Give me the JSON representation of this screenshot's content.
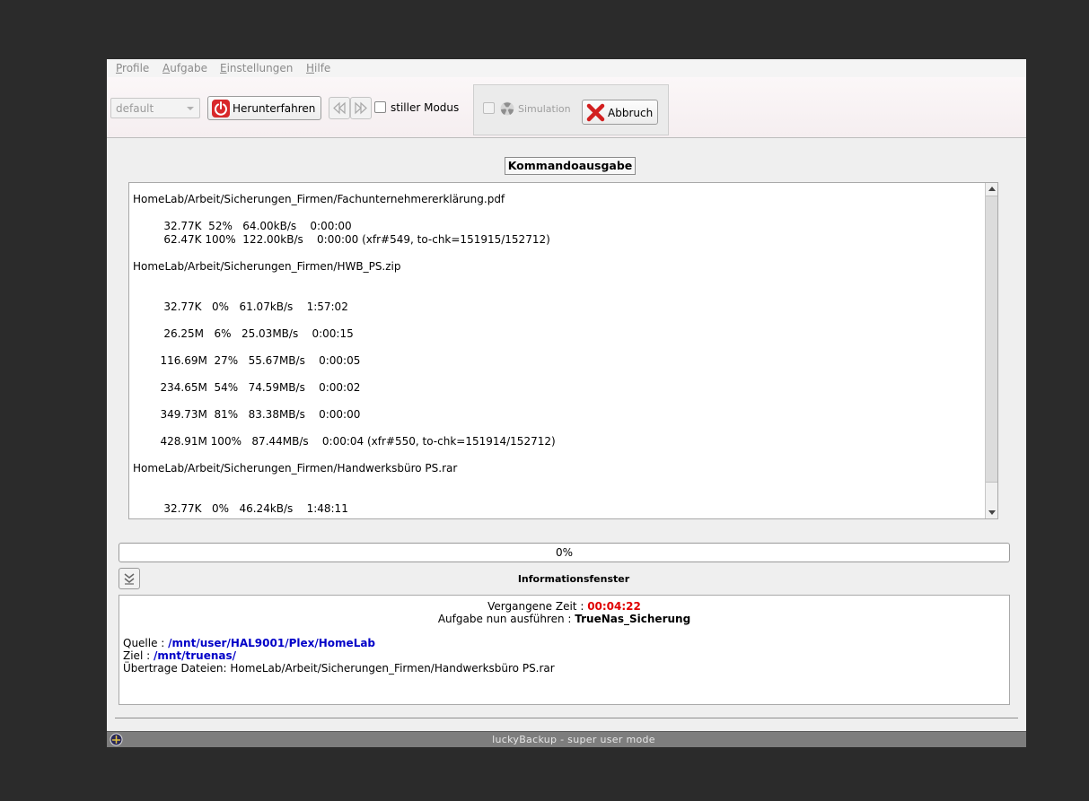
{
  "menubar": {
    "items": [
      {
        "pre": "",
        "u": "P",
        "post": "rofile"
      },
      {
        "pre": "",
        "u": "A",
        "post": "ufgabe"
      },
      {
        "pre": "",
        "u": "E",
        "post": "instellungen"
      },
      {
        "pre": "",
        "u": "H",
        "post": "ilfe"
      }
    ]
  },
  "toolbar": {
    "profile_value": "default",
    "shutdown_label": "Herunterfahren",
    "silent_label": "stiller Modus",
    "simulation_label": "Simulation",
    "abort_label": "Abbruch"
  },
  "command_output": {
    "title": "Kommandoausgabe",
    "lines": [
      "HomeLab/Arbeit/Sicherungen_Firmen/Fachunternehmererklärung.pdf",
      "",
      "         32.77K  52%   64.00kB/s    0:00:00",
      "         62.47K 100%  122.00kB/s    0:00:00 (xfr#549, to-chk=151915/152712)",
      "",
      "HomeLab/Arbeit/Sicherungen_Firmen/HWB_PS.zip",
      "",
      "",
      "         32.77K   0%   61.07kB/s    1:57:02",
      "",
      "         26.25M   6%   25.03MB/s    0:00:15",
      "",
      "        116.69M  27%   55.67MB/s    0:00:05",
      "",
      "        234.65M  54%   74.59MB/s    0:00:02",
      "",
      "        349.73M  81%   83.38MB/s    0:00:00",
      "",
      "        428.91M 100%   87.44MB/s    0:00:04 (xfr#550, to-chk=151914/152712)",
      "",
      "HomeLab/Arbeit/Sicherungen_Firmen/Handwerksbüro PS.rar",
      "",
      "",
      "         32.77K   0%   46.24kB/s    1:48:11"
    ]
  },
  "progress": {
    "value": 0,
    "text": "0%"
  },
  "info": {
    "title": "Informationsfenster",
    "elapsed_label": "Vergangene Zeit : ",
    "elapsed_value": "00:04:22",
    "task_label": "Aufgabe nun ausführen : ",
    "task_value": "TrueNas_Sicherung",
    "source_label": "Quelle : ",
    "source_value": "/mnt/user/HAL9001/Plex/HomeLab",
    "dest_label": "Ziel : ",
    "dest_value": "/mnt/truenas/",
    "transfer_label": "Übertrage Dateien: ",
    "transfer_value": "HomeLab/Arbeit/Sicherungen_Firmen/Handwerksbüro PS.rar"
  },
  "statusbar": {
    "text": "luckyBackup - super user mode"
  },
  "colors": {
    "elapsed": "#e00000",
    "path": "#0000c8",
    "progress_fill": "#6a9fd8"
  }
}
